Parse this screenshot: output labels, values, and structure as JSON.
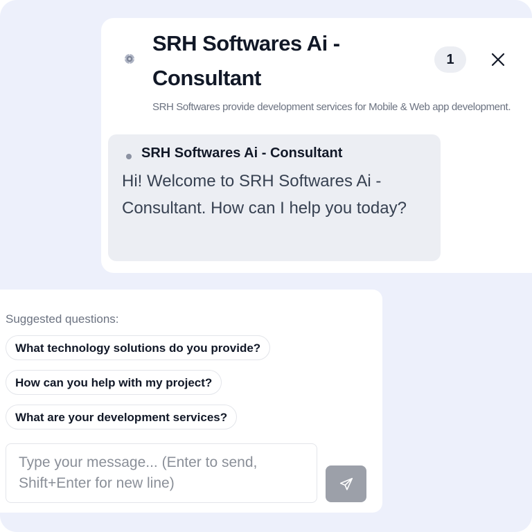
{
  "header": {
    "title": "SRH Softwares Ai - Consultant",
    "unread_count": "1",
    "description": "SRH Softwares provide development services for Mobile & Web app development.",
    "logo_icon": "bot-logo-icon",
    "close_icon": "close-icon"
  },
  "messages": [
    {
      "sender": "SRH Softwares Ai - Consultant",
      "text": "Hi! Welcome to SRH Softwares Ai - Consultant. How can I help you today?"
    }
  ],
  "suggestions": {
    "label": "Suggested questions:",
    "items": [
      "What technology solutions do you provide?",
      "How can you help with my project?",
      "What are your development services?"
    ]
  },
  "composer": {
    "placeholder": "Type your message... (Enter to send, Shift+Enter for new line)",
    "value": "",
    "send_icon": "send-icon"
  },
  "colors": {
    "page_background": "#edf0fb",
    "panel_background": "#ffffff",
    "bubble_background": "#eceef3",
    "send_button_disabled": "#9ca0a9",
    "text_primary": "#111827",
    "text_muted": "#6b7280"
  }
}
